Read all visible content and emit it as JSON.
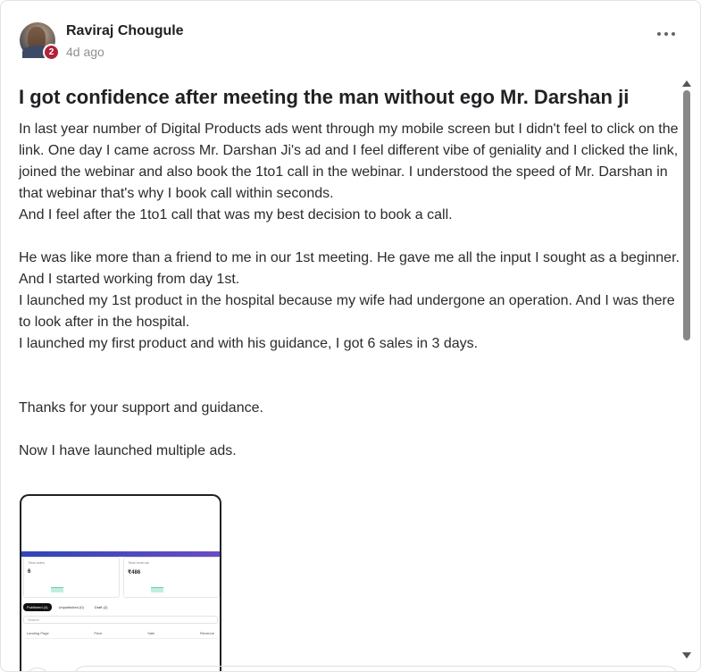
{
  "post": {
    "author": "Raviraj Chougule",
    "level": "2",
    "time": "4d ago",
    "title": "I got confidence after meeting the man without ego Mr. Darshan ji",
    "paragraphs": [
      "In last year number of Digital Products ads went through my mobile screen but I didn't feel to click on the link. One day I came across Mr. Darshan Ji's ad and I feel different vibe of geniality and I clicked the link, joined the webinar and also book the 1to1 call in the webinar. I understood the speed of Mr. Darshan in that webinar that's why I book call within seconds.",
      "And I feel after the 1to1 call that was my best decision to book a call.",
      "",
      "He was like more than a friend to me in our 1st meeting. He gave me all the input I sought as a beginner.",
      "And I started working from day 1st.",
      "I launched my 1st product in the hospital because my wife had undergone an operation. And I was there to look after in the hospital.",
      "I launched my first product and with his guidance, I got 6 sales in 3 days.",
      "",
      "",
      "Thanks for your support and guidance.",
      "",
      "Now I have launched multiple ads."
    ]
  },
  "screenshot": {
    "card1_label": "Total sales",
    "card1_value": "6",
    "card2_label": "Total revenue",
    "card2_value": "₹486",
    "tabs": [
      "Published (4)",
      "Unpublished (0)",
      "Draft (2)"
    ],
    "search_placeholder": "Search",
    "columns": [
      "Landing Page",
      "Price",
      "Sale",
      "Revenue"
    ]
  },
  "icons": {
    "more": "more-horizontal-icon",
    "scroll_up": "scroll-up-arrow-icon",
    "scroll_down": "scroll-down-arrow-icon"
  },
  "colors": {
    "level_badge": "#b0213a",
    "text": "#202124",
    "muted": "#909090"
  }
}
